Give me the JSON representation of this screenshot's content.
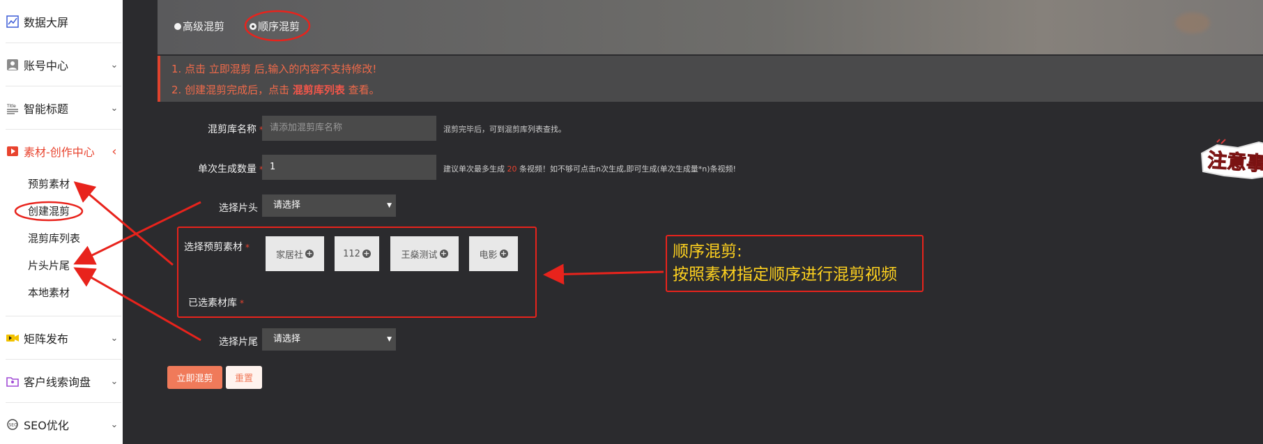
{
  "sidebar": {
    "items": [
      {
        "label": "数据大屏",
        "icon": "chart-line-icon"
      },
      {
        "label": "账号中心",
        "icon": "user-card-icon"
      },
      {
        "label": "智能标题",
        "icon": "title-icon"
      },
      {
        "label": "素材-创作中心",
        "icon": "video-play-icon",
        "active": true
      },
      {
        "label": "矩阵发布",
        "icon": "video-camera-icon"
      },
      {
        "label": "客户线索询盘",
        "icon": "folder-user-icon"
      },
      {
        "label": "SEO优化",
        "icon": "seo-icon"
      }
    ],
    "sub_items": [
      "预剪素材",
      "创建混剪",
      "混剪库列表",
      "片头片尾",
      "本地素材"
    ]
  },
  "mode": {
    "options": [
      "高级混剪",
      "顺序混剪"
    ],
    "selected": "顺序混剪"
  },
  "notice": {
    "line1": "1. 点击 立即混剪 后,输入的内容不支持修改!",
    "line2_prefix": "2. 创建混剪完成后，点击",
    "line2_link": "混剪库列表",
    "line2_suffix": "查看。"
  },
  "form": {
    "library_name": {
      "label": "混剪库名称",
      "placeholder": "请添加混剪库名称",
      "hint": "混剪完毕后，可到混剪库列表查找。"
    },
    "count": {
      "label": "单次生成数量",
      "value": "1",
      "hint_prefix": "建议单次最多生成",
      "hint_number": "20",
      "hint_suffix": "条视频！如不够可点击n次生成,即可生成(单次生成量*n)条视频!"
    },
    "intro": {
      "label": "选择片头",
      "value": "请选择"
    },
    "materials": {
      "label": "选择预剪素材",
      "options": [
        "家居社",
        "112",
        "王燊测试",
        "电影"
      ]
    },
    "selected_library": {
      "label": "已选素材库"
    },
    "outro": {
      "label": "选择片尾",
      "value": "请选择"
    },
    "required_mark": "*"
  },
  "buttons": {
    "submit": "立即混剪",
    "reset": "重置"
  },
  "annotation": {
    "title": "顺序混剪:",
    "body": "按照素材指定顺序进行混剪视频",
    "sticker": "注意事项"
  },
  "colors": {
    "accent": "#e8432e",
    "annotation": "#ffd21f",
    "primary_button": "#f07a5a"
  }
}
